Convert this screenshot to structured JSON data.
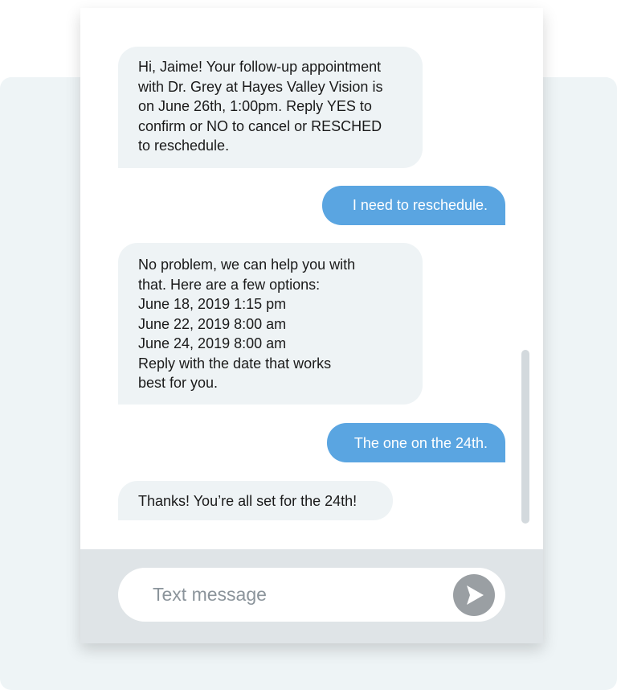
{
  "conversation": {
    "messages": [
      {
        "direction": "incoming",
        "lines": [
          "Hi, Jaime! Your follow-up appointment",
          "with Dr. Grey at Hayes Valley Vision is",
          "on June 26th, 1:00pm. Reply YES to",
          "confirm or NO to cancel or RESCHED",
          "to reschedule."
        ]
      },
      {
        "direction": "outgoing",
        "lines": [
          "I need to reschedule."
        ]
      },
      {
        "direction": "incoming",
        "lines": [
          "No problem, we can help you with",
          "that. Here are a few options:",
          "June 18, 2019 1:15 pm",
          "June 22, 2019 8:00 am",
          "June 24, 2019 8:00 am",
          "Reply with the date that works",
          "best for you."
        ]
      },
      {
        "direction": "outgoing",
        "lines": [
          "The one on the 24th."
        ]
      },
      {
        "direction": "incoming",
        "lines": [
          "Thanks! You’re all set for the 24th!"
        ]
      }
    ]
  },
  "composer": {
    "placeholder": "Text message",
    "send_icon": "send-arrow-icon"
  },
  "colors": {
    "outgoing_bubble": "#5aa5e1",
    "incoming_bubble": "#eef3f5",
    "background_panel": "#eef4f6",
    "composer_bar": "#dfe4e7",
    "send_button": "#9a9fa3"
  }
}
